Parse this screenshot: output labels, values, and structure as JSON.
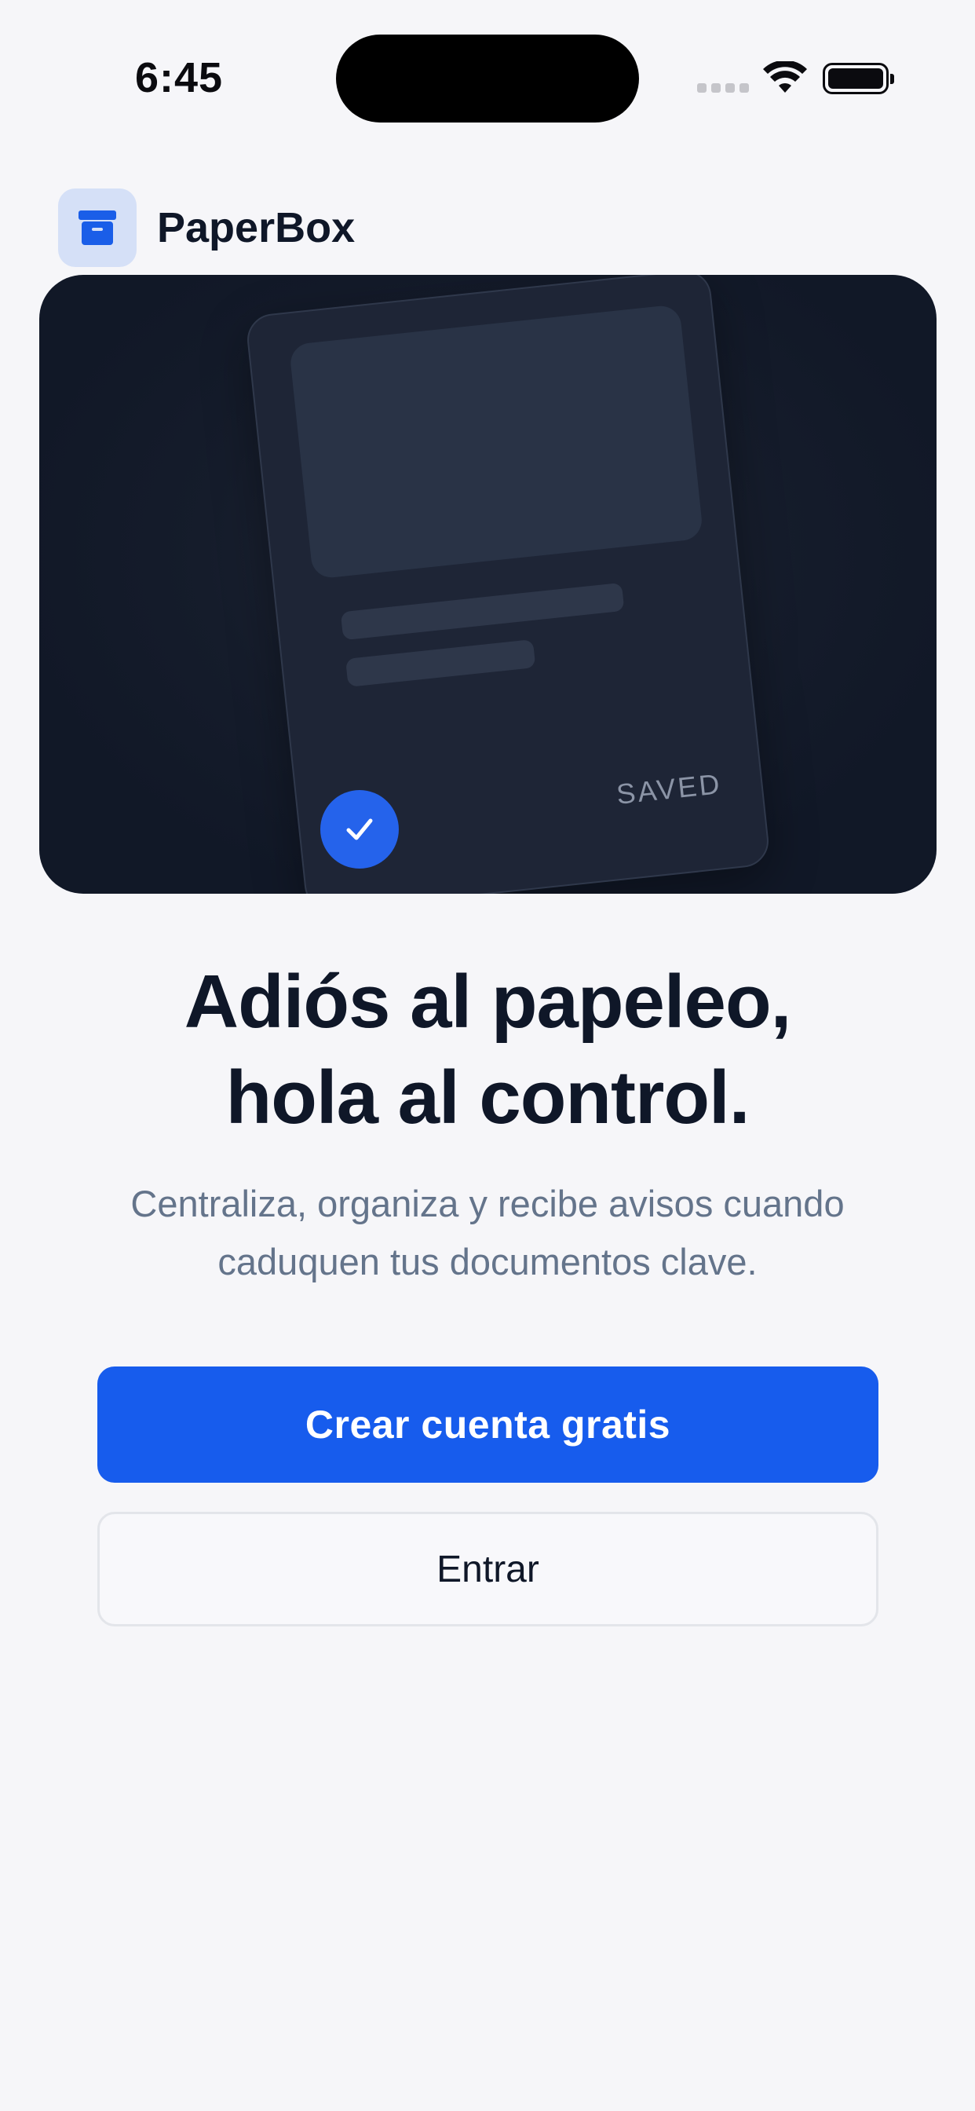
{
  "status_bar": {
    "time": "6:45",
    "icons": [
      "signal-icon",
      "wifi-icon",
      "battery-icon"
    ]
  },
  "brand": {
    "name": "PaperBox",
    "icon": "archive-box-icon"
  },
  "hero": {
    "saved_label": "SAVED",
    "check_icon": "check-icon"
  },
  "headline": {
    "line1": "Adiós al papeleo,",
    "line2": "hola al control."
  },
  "subtitle": {
    "line1": "Centraliza, organiza y recibe avisos cuando",
    "line2": "caduquen tus documentos clave."
  },
  "actions": {
    "primary_label": "Crear cuenta gratis",
    "secondary_label": "Entrar"
  },
  "colors": {
    "accent": "#175ced",
    "brand_icon_bg": "#d5e0f7",
    "hero_bg": "#111827",
    "text_primary": "#0f1728",
    "text_secondary": "#64748b",
    "background": "#f6f6f9"
  }
}
